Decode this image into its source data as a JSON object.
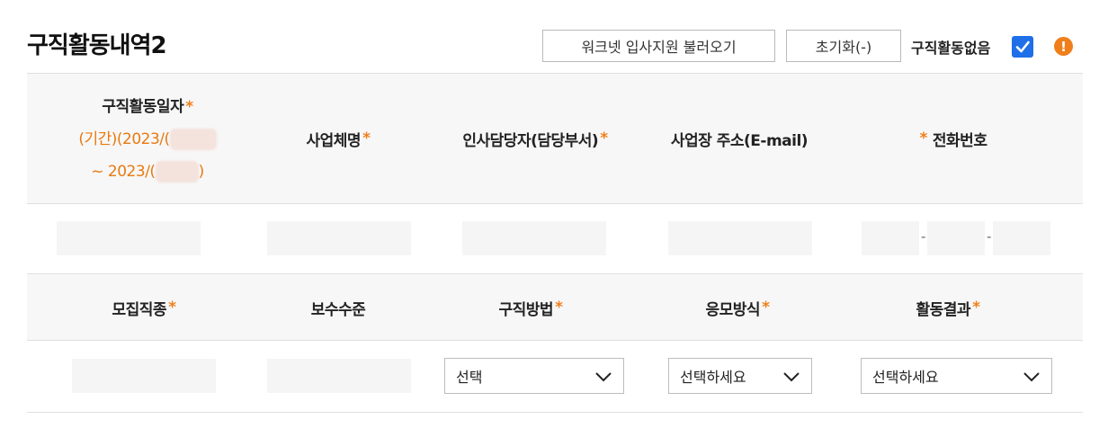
{
  "header": {
    "title": "구직활동내역2",
    "worknet_button": "워크넷 입사지원 불러오기",
    "reset_button": "초기화(-)",
    "no_activity_label": "구직활동없음",
    "no_activity_checked": true,
    "warning_icon": "exclamation-circle-icon",
    "accent_color": "#f07f1b",
    "checkbox_color": "#1e6fe8"
  },
  "table1": {
    "headers": {
      "date_label": "구직활동일자",
      "period_prefix": "(기간)(2023/(",
      "period_suffix_start": "~ 2023/(",
      "period_suffix_end": ")",
      "company": "사업체명",
      "hr_manager": "인사담당자(담당부서)",
      "address": "사업장 주소(E-mail)",
      "phone": "전화번호"
    },
    "required_mark": "*",
    "phone_separator": "-"
  },
  "table2": {
    "headers": {
      "job_type": "모집직종",
      "salary": "보수수준",
      "method": "구직방법",
      "apply_method": "응모방식",
      "result": "활동결과"
    },
    "selects": {
      "method": "선택",
      "apply_method": "선택하세요",
      "result": "선택하세요"
    }
  }
}
